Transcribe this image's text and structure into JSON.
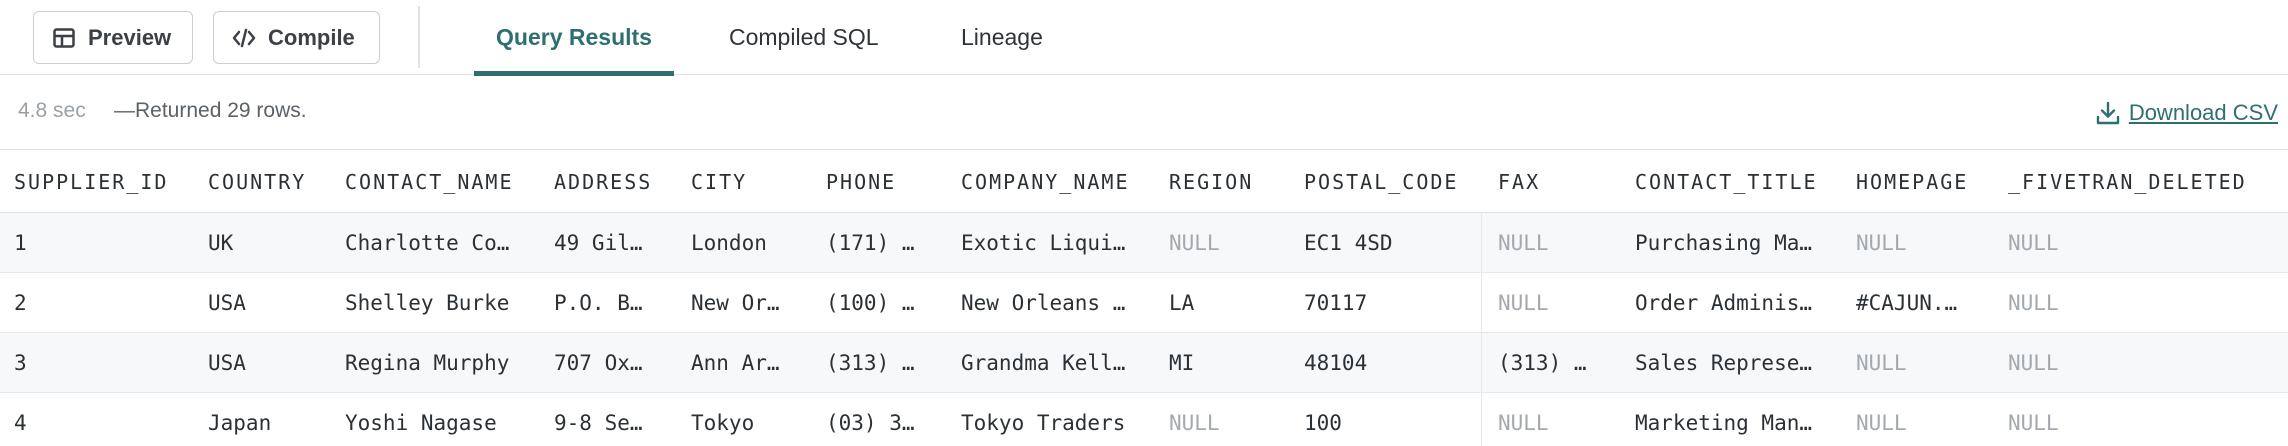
{
  "toolbar": {
    "preview_label": "Preview",
    "compile_label": "Compile",
    "tabs": [
      {
        "label": "Query Results",
        "active": true
      },
      {
        "label": "Compiled SQL",
        "active": false
      },
      {
        "label": "Lineage",
        "active": false
      }
    ]
  },
  "status": {
    "elapsed": "4.8 sec",
    "message": "—Returned 29 rows.",
    "download_label": "Download CSV"
  },
  "colors": {
    "accent": "#2f6f6f",
    "null_text": "#a4a9ae",
    "border": "#dfe3e6"
  },
  "table": {
    "columns": [
      "SUPPLIER_ID",
      "COUNTRY",
      "CONTACT_NAME",
      "ADDRESS",
      "CITY",
      "PHONE",
      "COMPANY_NAME",
      "REGION",
      "POSTAL_CODE",
      "FAX",
      "CONTACT_TITLE",
      "HOMEPAGE",
      "_FIVETRAN_DELETED"
    ],
    "rows": [
      [
        "1",
        "UK",
        "Charlotte Co…",
        "49 Gil…",
        "London",
        "(171) …",
        "Exotic Liqui…",
        "NULL",
        "EC1 4SD",
        "NULL",
        "Purchasing Ma…",
        "NULL",
        "NULL"
      ],
      [
        "2",
        "USA",
        "Shelley Burke",
        "P.O. B…",
        "New Or…",
        "(100) …",
        "New Orleans …",
        "LA",
        "70117",
        "NULL",
        "Order Adminis…",
        "#CAJUN.…",
        "NULL"
      ],
      [
        "3",
        "USA",
        "Regina Murphy",
        "707 Ox…",
        "Ann Ar…",
        "(313) …",
        "Grandma Kell…",
        "MI",
        "48104",
        "(313) …",
        "Sales Represe…",
        "NULL",
        "NULL"
      ],
      [
        "4",
        "Japan",
        "Yoshi Nagase",
        "9-8 Se…",
        "Tokyo",
        "(03) 3…",
        "Tokyo Traders",
        "NULL",
        "100",
        "NULL",
        "Marketing Man…",
        "NULL",
        "NULL"
      ]
    ]
  }
}
